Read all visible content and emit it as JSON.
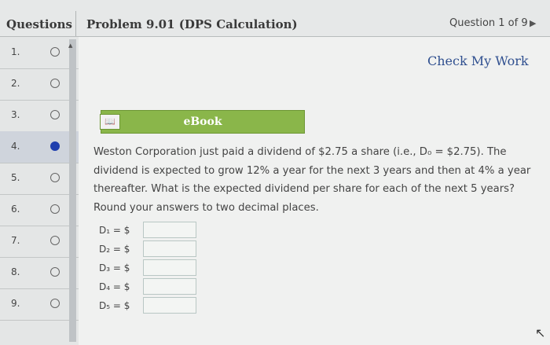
{
  "header": {
    "questions_label": "Questions",
    "problem_title": "Problem 9.01 (DPS Calculation)",
    "question_counter": "Question 1 of 9",
    "next_icon": "triangle-right-icon"
  },
  "sidebar": {
    "items": [
      {
        "number": "1.",
        "status": "unanswered"
      },
      {
        "number": "2.",
        "status": "unanswered"
      },
      {
        "number": "3.",
        "status": "unanswered"
      },
      {
        "number": "4.",
        "status": "current"
      },
      {
        "number": "5.",
        "status": "unanswered"
      },
      {
        "number": "6.",
        "status": "unanswered"
      },
      {
        "number": "7.",
        "status": "unanswered"
      },
      {
        "number": "8.",
        "status": "unanswered"
      },
      {
        "number": "9.",
        "status": "unanswered"
      }
    ]
  },
  "main": {
    "check_work_label": "Check My Work",
    "ebook_label": "eBook",
    "problem_text": "Weston Corporation just paid a dividend of $2.75 a share (i.e., D₀ = $2.75). The dividend is expected to grow 12% a year for the next 3 years and then at 4% a year thereafter. What is the expected dividend per share for each of the next 5 years? Round your answers to two decimal places.",
    "answers": [
      {
        "label": "D₁ = $",
        "value": ""
      },
      {
        "label": "D₂ = $",
        "value": ""
      },
      {
        "label": "D₃ = $",
        "value": ""
      },
      {
        "label": "D₄ = $",
        "value": ""
      },
      {
        "label": "D₅ = $",
        "value": ""
      }
    ]
  },
  "colors": {
    "ebook_bar": "#8ab64a",
    "link": "#2f4f8f",
    "current_marker": "#1f3fae"
  }
}
